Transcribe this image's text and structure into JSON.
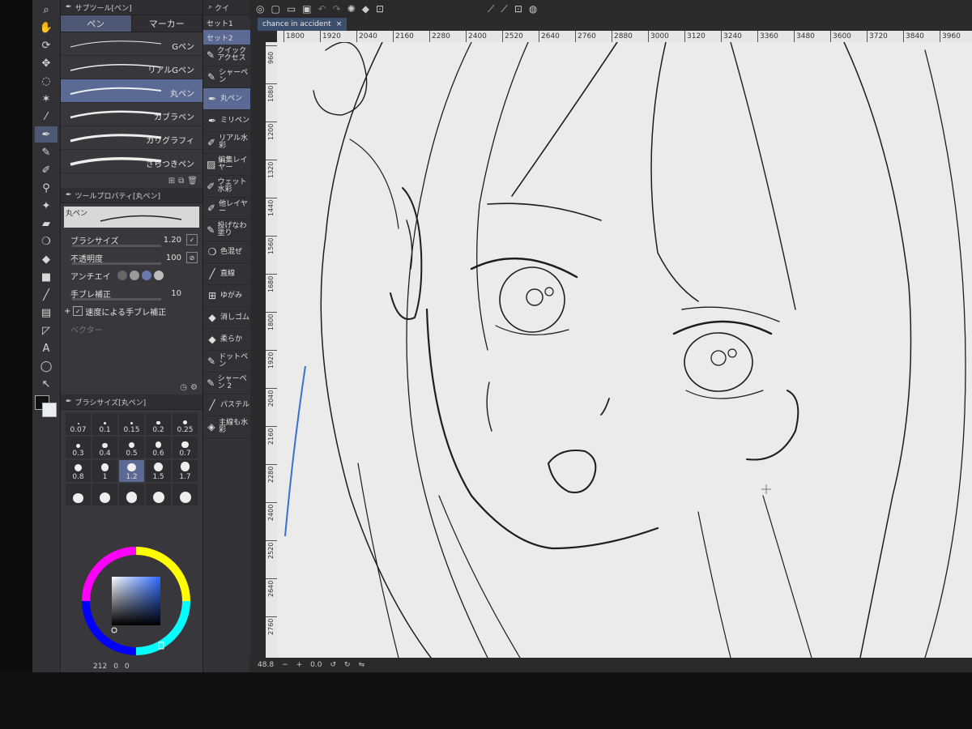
{
  "document": {
    "tab_title": "chance in accident",
    "close_icon": "close-icon"
  },
  "tools": [
    {
      "name": "zoom-icon",
      "glyph": "⌕"
    },
    {
      "name": "hand-icon",
      "glyph": "✋"
    },
    {
      "name": "rotate-icon",
      "glyph": "⟳"
    },
    {
      "name": "move-icon",
      "glyph": "✥"
    },
    {
      "name": "lasso-icon",
      "glyph": "◌"
    },
    {
      "name": "magic-wand-icon",
      "glyph": "✶"
    },
    {
      "name": "eyedropper-icon",
      "glyph": "⁄"
    },
    {
      "name": "pen-icon",
      "glyph": "✒",
      "active": true
    },
    {
      "name": "pencil-icon",
      "glyph": "✎"
    },
    {
      "name": "brush-icon",
      "glyph": "✐"
    },
    {
      "name": "airbrush-icon",
      "glyph": "⚲"
    },
    {
      "name": "decoration-icon",
      "glyph": "✦"
    },
    {
      "name": "eraser-icon",
      "glyph": "▰"
    },
    {
      "name": "blend-icon",
      "glyph": "❍"
    },
    {
      "name": "fill-icon",
      "glyph": "◆"
    },
    {
      "name": "gradient-icon",
      "glyph": "■"
    },
    {
      "name": "figure-icon",
      "glyph": "╱"
    },
    {
      "name": "frame-icon",
      "glyph": "▤"
    },
    {
      "name": "ruler-icon",
      "glyph": "◸"
    },
    {
      "name": "text-icon",
      "glyph": "A"
    },
    {
      "name": "balloon-icon",
      "glyph": "◯"
    },
    {
      "name": "correct-line-icon",
      "glyph": "↖"
    }
  ],
  "subtool_panel": {
    "title": "サブツール[ペン]",
    "tabs": [
      {
        "label": "ペン",
        "active": true
      },
      {
        "label": "マーカー",
        "active": false
      }
    ],
    "brushes": [
      {
        "label": "Gペン",
        "active": false
      },
      {
        "label": "リアルGペン",
        "active": false
      },
      {
        "label": "丸ペン",
        "active": true
      },
      {
        "label": "カブラペン",
        "active": false
      },
      {
        "label": "カリグラフィ",
        "active": false
      },
      {
        "label": "ざらつきペン",
        "active": false
      }
    ]
  },
  "tool_property": {
    "title": "ツールプロパティ[丸ペン]",
    "preview_label": "丸ペン",
    "brush_size_label": "ブラシサイズ",
    "brush_size_value": "1.20",
    "opacity_label": "不透明度",
    "opacity_value": "100",
    "antialias_label": "アンチエイ",
    "stabilization_label": "手ブレ補正",
    "stabilization_value": "10",
    "speed_stabilization_label": "速度による手ブレ補正",
    "vector_label": "ベクター"
  },
  "brush_size_panel": {
    "title": "ブラシサイズ[丸ペン]",
    "sizes": [
      "0.07",
      "0.1",
      "0.15",
      "0.2",
      "0.25",
      "0.3",
      "0.4",
      "0.5",
      "0.6",
      "0.7",
      "0.8",
      "1",
      "1.2",
      "1.5",
      "1.7",
      "",
      "",
      "",
      "",
      ""
    ],
    "active_index": 12
  },
  "quick_access": {
    "title": "クイ",
    "sets": [
      {
        "label": "セット1",
        "active": false
      },
      {
        "label": "セット2",
        "active": true
      }
    ],
    "items": [
      {
        "label": "クイック アクセス",
        "icon": "quick-access-icon",
        "glyph": "✎",
        "active": false
      },
      {
        "label": "シャーペン",
        "icon": "mechanical-pencil-icon",
        "glyph": "✎",
        "active": false
      },
      {
        "label": "丸ペン",
        "icon": "round-pen-icon",
        "glyph": "✒",
        "active": true
      },
      {
        "label": "ミリペン",
        "icon": "milli-pen-icon",
        "glyph": "✒",
        "active": false
      },
      {
        "label": "リアル水彩",
        "icon": "watercolor-icon",
        "glyph": "✐",
        "active": false
      },
      {
        "label": "編集レイヤー",
        "icon": "edit-layer-icon",
        "glyph": "▨",
        "active": false
      },
      {
        "label": "ウェット水彩",
        "icon": "wet-watercolor-icon",
        "glyph": "✐",
        "active": false
      },
      {
        "label": "他レイヤー",
        "icon": "other-layer-icon",
        "glyph": "✐",
        "active": false
      },
      {
        "label": "投げなわ塗り",
        "icon": "lasso-fill-icon",
        "glyph": "✎",
        "active": false
      },
      {
        "label": "色混ぜ",
        "icon": "color-mix-icon",
        "glyph": "❍",
        "active": false
      },
      {
        "label": "直線",
        "icon": "straight-line-icon",
        "glyph": "╱",
        "active": false
      },
      {
        "label": "ゆがみ",
        "icon": "distortion-icon",
        "glyph": "⊞",
        "active": false
      },
      {
        "label": "消しゴム",
        "icon": "eraser-icon",
        "glyph": "◆",
        "active": false
      },
      {
        "label": "柔らか",
        "icon": "soft-icon",
        "glyph": "◆",
        "active": false
      },
      {
        "label": "ドットペン",
        "icon": "dot-pen-icon",
        "glyph": "✎",
        "active": false
      },
      {
        "label": "シャーペン 2",
        "icon": "mechanical-pencil-2-icon",
        "glyph": "✎",
        "active": false
      },
      {
        "label": "パステル",
        "icon": "pastel-icon",
        "glyph": "╱",
        "active": false
      },
      {
        "label": "主線も水彩",
        "icon": "main-line-watercolor-icon",
        "glyph": "◈",
        "active": false
      }
    ]
  },
  "rulers": {
    "h_ticks": [
      "1800",
      "1920",
      "2040",
      "2160",
      "2280",
      "2400",
      "2520",
      "2640",
      "2760",
      "2880",
      "3000",
      "3120",
      "3240",
      "3360",
      "3480",
      "3600",
      "3720",
      "3840",
      "3960"
    ],
    "v_ticks": [
      "960",
      "1080",
      "1200",
      "1320",
      "1440",
      "1560",
      "1680",
      "1800",
      "1920",
      "2040",
      "2160",
      "2280",
      "2400",
      "2520",
      "2640",
      "2760"
    ]
  },
  "status": {
    "zoom": "48.8",
    "angle": "0.0"
  },
  "footer": {
    "size": "212",
    "v1": "0",
    "v2": "0"
  },
  "colors": {
    "accent": "#5a6a94",
    "panel": "#38383c"
  }
}
